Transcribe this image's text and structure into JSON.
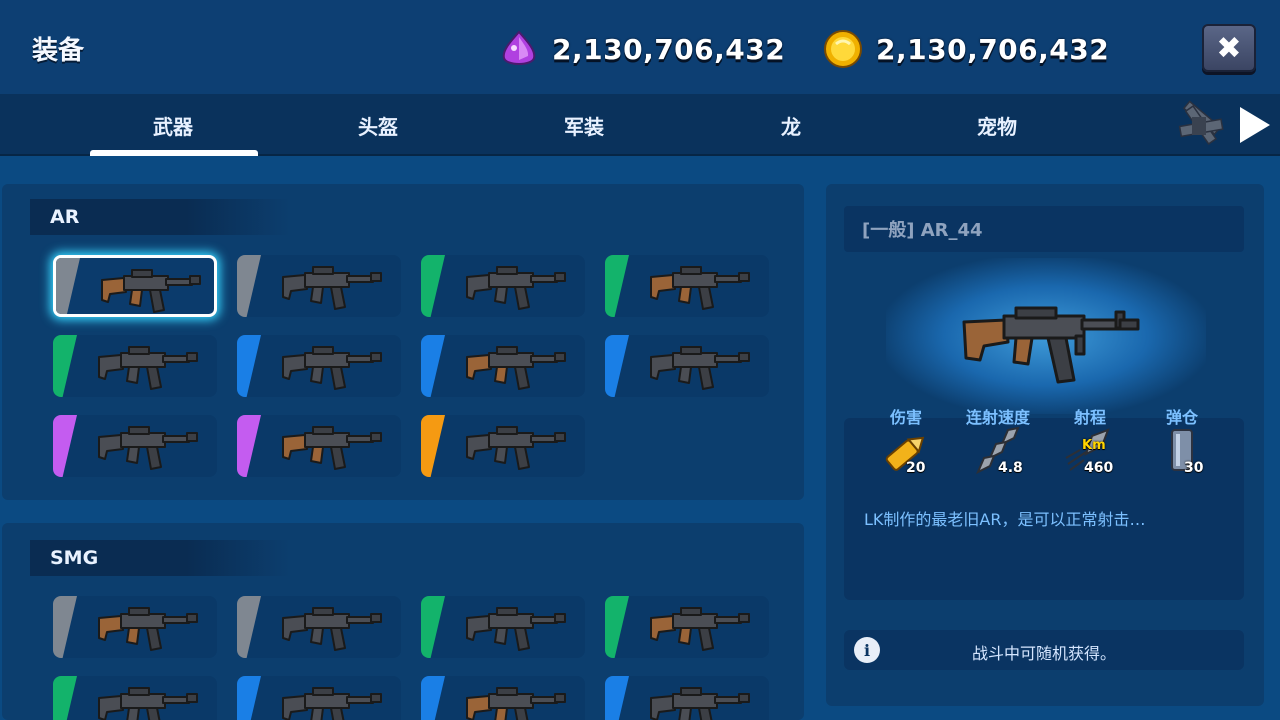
{
  "header": {
    "title": "装备",
    "gems": "2,130,706,432",
    "coins": "2,130,706,432"
  },
  "tabs": [
    {
      "label": "武器",
      "active": true
    },
    {
      "label": "头盔",
      "active": false
    },
    {
      "label": "军装",
      "active": false
    },
    {
      "label": "龙",
      "active": false
    },
    {
      "label": "宠物",
      "active": false
    }
  ],
  "rarity_colors": {
    "gray": "#7f8791",
    "green": "#13b36b",
    "blue": "#1a7fe6",
    "purple": "#c45cf0",
    "orange": "#f59a12"
  },
  "sections": [
    {
      "label": "AR",
      "items": [
        {
          "rarity": "gray",
          "selected": true
        },
        {
          "rarity": "gray"
        },
        {
          "rarity": "green"
        },
        {
          "rarity": "green"
        },
        {
          "rarity": "green"
        },
        {
          "rarity": "blue"
        },
        {
          "rarity": "blue"
        },
        {
          "rarity": "blue"
        },
        {
          "rarity": "purple"
        },
        {
          "rarity": "purple"
        },
        {
          "rarity": "orange"
        }
      ]
    },
    {
      "label": "SMG",
      "items": [
        {
          "rarity": "gray"
        },
        {
          "rarity": "gray"
        },
        {
          "rarity": "green"
        },
        {
          "rarity": "green"
        },
        {
          "rarity": "green"
        },
        {
          "rarity": "blue"
        },
        {
          "rarity": "blue"
        },
        {
          "rarity": "blue"
        }
      ]
    }
  ],
  "detail": {
    "name": "[一般] AR_44",
    "stats": [
      {
        "label": "伤害",
        "value": "20",
        "icon": "bullet-icon"
      },
      {
        "label": "连射速度",
        "value": "4.8",
        "icon": "fire-rate-icon"
      },
      {
        "label": "射程",
        "value": "460",
        "icon": "range-icon"
      },
      {
        "label": "弹仓",
        "value": "30",
        "icon": "magazine-icon"
      }
    ],
    "range_unit": "Km",
    "description": "LK制作的最老旧AR，是可以正常射击…",
    "info": "战斗中可随机获得。"
  }
}
